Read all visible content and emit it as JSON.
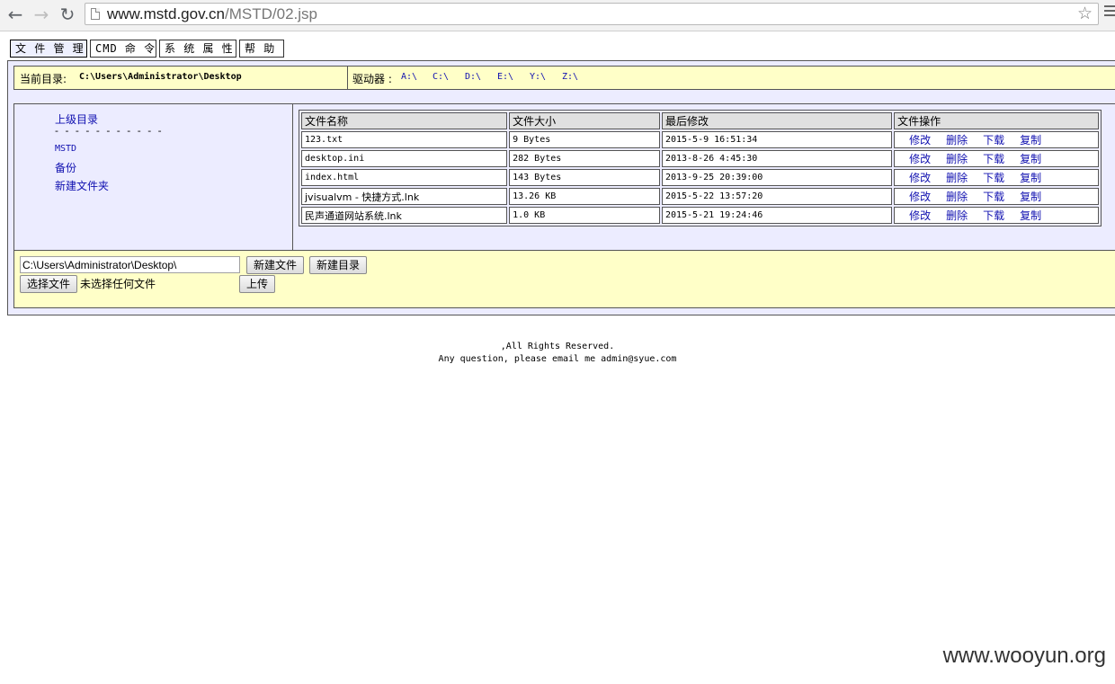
{
  "browser": {
    "url_host": "www.mstd.gov.cn",
    "url_path": "/MSTD/02.jsp",
    "back_icon": "←",
    "forward_icon": "→",
    "reload_icon": "↻",
    "bookmark_icon": "☆"
  },
  "tabs": [
    {
      "label": "文 件 管 理",
      "active": true
    },
    {
      "label": "CMD 命 令",
      "active": false
    },
    {
      "label": "系 统 属 性",
      "active": false
    },
    {
      "label": "帮 助",
      "active": false
    }
  ],
  "dir_bar": {
    "current_label": "当前目录:",
    "current_path": "C:\\Users\\Administrator\\Desktop",
    "drives_label": "驱动器 :",
    "drives": [
      "A:\\",
      "C:\\",
      "D:\\",
      "E:\\",
      "Y:\\",
      "Z:\\"
    ]
  },
  "sidebar": {
    "parent_dir": "上级目录",
    "separator": "- - - - - - - - - - -",
    "folders": [
      "MSTD",
      "备份",
      "新建文件夹"
    ]
  },
  "file_table": {
    "headers": [
      "文件名称",
      "文件大小",
      "最后修改",
      "文件操作"
    ],
    "operations": [
      "修改",
      "删除",
      "下载",
      "复制"
    ],
    "rows": [
      {
        "name": "123.txt",
        "size": "9 Bytes",
        "modified": "2015-5-9 16:51:34"
      },
      {
        "name": "desktop.ini",
        "size": "282 Bytes",
        "modified": "2013-8-26 4:45:30"
      },
      {
        "name": "index.html",
        "size": "143 Bytes",
        "modified": "2013-9-25 20:39:00"
      },
      {
        "name": "jvisualvm - 快捷方式.lnk",
        "size": "13.26 KB",
        "modified": "2015-5-22 13:57:20"
      },
      {
        "name": "民声通道网站系统.lnk",
        "size": "1.0 KB",
        "modified": "2015-5-21 19:24:46"
      }
    ]
  },
  "bottom": {
    "path_value": "C:\\Users\\Administrator\\Desktop\\",
    "new_file_button": "新建文件",
    "new_dir_button": "新建目录",
    "choose_file_button": "选择文件",
    "no_file_text": "未选择任何文件",
    "upload_button": "上传"
  },
  "footer": {
    "line1": ",All Rights Reserved.",
    "line2": "Any question, please email me admin@syue.com"
  },
  "watermark": "www.wooyun.org"
}
